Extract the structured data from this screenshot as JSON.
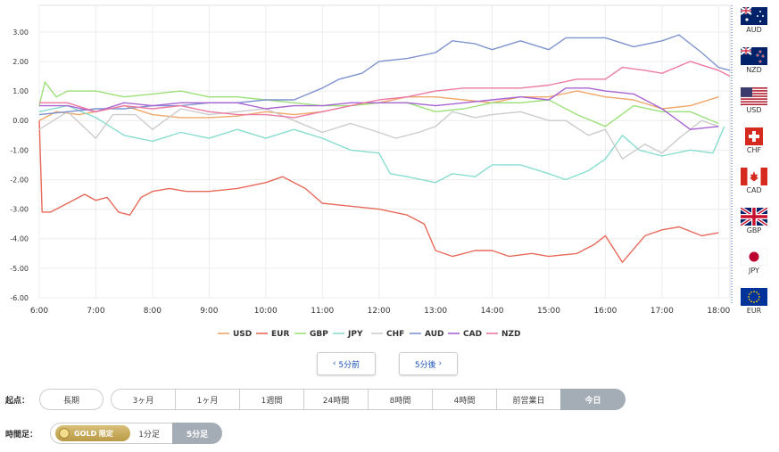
{
  "chart_data": {
    "type": "line",
    "title": "",
    "xlabel": "",
    "ylabel": "",
    "x_ticks": [
      "6:00",
      "7:00",
      "8:00",
      "9:00",
      "10:00",
      "11:00",
      "12:00",
      "13:00",
      "14:00",
      "15:00",
      "16:00",
      "17:00",
      "18:00"
    ],
    "x_range": [
      6.0,
      18.2
    ],
    "ylim": [
      -6.0,
      3.9
    ],
    "y_ticks": [
      "3.00",
      "2.00",
      "1.00",
      "0.00",
      "-1.00",
      "-2.00",
      "-3.00",
      "-4.00",
      "-5.00",
      "-6.00"
    ],
    "grid": true,
    "legend_position": "bottom",
    "series": [
      {
        "name": "USD",
        "color": "#f0a76a",
        "points": [
          [
            6,
            0
          ],
          [
            6.3,
            0.3
          ],
          [
            6.7,
            0.2
          ],
          [
            7,
            0.3
          ],
          [
            7.5,
            0.5
          ],
          [
            8,
            0.2
          ],
          [
            8.5,
            0.1
          ],
          [
            9,
            0.1
          ],
          [
            9.5,
            0.15
          ],
          [
            10,
            0.3
          ],
          [
            10.5,
            0.2
          ],
          [
            11,
            0.3
          ],
          [
            11.5,
            0.5
          ],
          [
            12,
            0.6
          ],
          [
            12.5,
            0.8
          ],
          [
            13,
            0.8
          ],
          [
            13.5,
            0.7
          ],
          [
            14,
            0.6
          ],
          [
            14.5,
            0.8
          ],
          [
            15,
            0.8
          ],
          [
            15.5,
            1.0
          ],
          [
            16,
            0.8
          ],
          [
            16.5,
            0.7
          ],
          [
            17,
            0.4
          ],
          [
            17.5,
            0.5
          ],
          [
            18,
            0.8
          ]
        ]
      },
      {
        "name": "EUR",
        "color": "#e8695a",
        "points": [
          [
            6,
            0
          ],
          [
            6.05,
            -3.1
          ],
          [
            6.2,
            -3.1
          ],
          [
            6.5,
            -2.8
          ],
          [
            6.8,
            -2.5
          ],
          [
            7,
            -2.7
          ],
          [
            7.2,
            -2.6
          ],
          [
            7.4,
            -3.1
          ],
          [
            7.6,
            -3.2
          ],
          [
            7.8,
            -2.6
          ],
          [
            8,
            -2.4
          ],
          [
            8.3,
            -2.3
          ],
          [
            8.6,
            -2.4
          ],
          [
            9,
            -2.4
          ],
          [
            9.5,
            -2.3
          ],
          [
            10,
            -2.1
          ],
          [
            10.3,
            -1.9
          ],
          [
            10.7,
            -2.3
          ],
          [
            11,
            -2.8
          ],
          [
            11.5,
            -2.9
          ],
          [
            12,
            -3.0
          ],
          [
            12.5,
            -3.2
          ],
          [
            12.8,
            -3.5
          ],
          [
            13,
            -4.4
          ],
          [
            13.3,
            -4.6
          ],
          [
            13.7,
            -4.4
          ],
          [
            14,
            -4.4
          ],
          [
            14.3,
            -4.6
          ],
          [
            14.7,
            -4.5
          ],
          [
            15,
            -4.6
          ],
          [
            15.5,
            -4.5
          ],
          [
            15.8,
            -4.2
          ],
          [
            16,
            -3.9
          ],
          [
            16.3,
            -4.8
          ],
          [
            16.7,
            -3.9
          ],
          [
            17,
            -3.7
          ],
          [
            17.3,
            -3.6
          ],
          [
            17.7,
            -3.9
          ],
          [
            18,
            -3.8
          ]
        ]
      },
      {
        "name": "GBP",
        "color": "#9de07a",
        "points": [
          [
            6,
            0.5
          ],
          [
            6.1,
            1.3
          ],
          [
            6.3,
            0.8
          ],
          [
            6.5,
            1.0
          ],
          [
            7,
            1.0
          ],
          [
            7.5,
            0.8
          ],
          [
            8,
            0.9
          ],
          [
            8.5,
            1.0
          ],
          [
            9,
            0.8
          ],
          [
            9.5,
            0.8
          ],
          [
            10,
            0.7
          ],
          [
            10.5,
            0.6
          ],
          [
            11,
            0.5
          ],
          [
            11.5,
            0.5
          ],
          [
            12,
            0.6
          ],
          [
            12.5,
            0.6
          ],
          [
            13,
            0.3
          ],
          [
            13.5,
            0.4
          ],
          [
            14,
            0.6
          ],
          [
            14.5,
            0.6
          ],
          [
            15,
            0.7
          ],
          [
            15.5,
            0.2
          ],
          [
            16,
            -0.2
          ],
          [
            16.5,
            0.5
          ],
          [
            17,
            0.3
          ],
          [
            17.5,
            0.3
          ],
          [
            18,
            -0.1
          ]
        ]
      },
      {
        "name": "JPY",
        "color": "#88ddd0",
        "points": [
          [
            6,
            0.3
          ],
          [
            6.5,
            0.5
          ],
          [
            7,
            0.1
          ],
          [
            7.5,
            -0.5
          ],
          [
            8,
            -0.7
          ],
          [
            8.5,
            -0.4
          ],
          [
            9,
            -0.6
          ],
          [
            9.5,
            -0.3
          ],
          [
            10,
            -0.6
          ],
          [
            10.5,
            -0.3
          ],
          [
            11,
            -0.6
          ],
          [
            11.5,
            -1.0
          ],
          [
            12,
            -1.1
          ],
          [
            12.2,
            -1.8
          ],
          [
            12.5,
            -1.9
          ],
          [
            13,
            -2.1
          ],
          [
            13.3,
            -1.8
          ],
          [
            13.7,
            -1.9
          ],
          [
            14,
            -1.5
          ],
          [
            14.5,
            -1.5
          ],
          [
            15,
            -1.8
          ],
          [
            15.3,
            -2.0
          ],
          [
            15.7,
            -1.7
          ],
          [
            16,
            -1.3
          ],
          [
            16.3,
            -0.5
          ],
          [
            16.6,
            -1.0
          ],
          [
            17,
            -1.2
          ],
          [
            17.5,
            -1.0
          ],
          [
            17.9,
            -1.1
          ],
          [
            18.1,
            -0.2
          ]
        ]
      },
      {
        "name": "CHF",
        "color": "#cccccc",
        "points": [
          [
            6,
            -0.3
          ],
          [
            6.5,
            0.3
          ],
          [
            7,
            -0.6
          ],
          [
            7.3,
            0.2
          ],
          [
            7.7,
            0.2
          ],
          [
            8,
            -0.3
          ],
          [
            8.5,
            0.4
          ],
          [
            9,
            0.2
          ],
          [
            9.5,
            0.3
          ],
          [
            10,
            0.4
          ],
          [
            10.5,
            0.0
          ],
          [
            11,
            -0.4
          ],
          [
            11.5,
            -0.1
          ],
          [
            12,
            -0.4
          ],
          [
            12.3,
            -0.6
          ],
          [
            12.7,
            -0.4
          ],
          [
            13,
            -0.2
          ],
          [
            13.3,
            0.3
          ],
          [
            13.7,
            0.1
          ],
          [
            14,
            0.2
          ],
          [
            14.5,
            0.3
          ],
          [
            15,
            0.0
          ],
          [
            15.3,
            0.0
          ],
          [
            15.7,
            -0.5
          ],
          [
            16,
            -0.3
          ],
          [
            16.3,
            -1.3
          ],
          [
            16.7,
            -0.8
          ],
          [
            17,
            -1.1
          ],
          [
            17.3,
            -0.6
          ],
          [
            17.7,
            0.0
          ],
          [
            18,
            -0.2
          ]
        ]
      },
      {
        "name": "AUD",
        "color": "#7e93cf",
        "points": [
          [
            6,
            0.2
          ],
          [
            6.5,
            0.3
          ],
          [
            7,
            0.4
          ],
          [
            7.5,
            0.4
          ],
          [
            8,
            0.5
          ],
          [
            8.5,
            0.5
          ],
          [
            9,
            0.6
          ],
          [
            9.5,
            0.6
          ],
          [
            10,
            0.7
          ],
          [
            10.5,
            0.7
          ],
          [
            11,
            1.1
          ],
          [
            11.3,
            1.4
          ],
          [
            11.7,
            1.6
          ],
          [
            12,
            2.0
          ],
          [
            12.5,
            2.1
          ],
          [
            13,
            2.3
          ],
          [
            13.3,
            2.7
          ],
          [
            13.7,
            2.6
          ],
          [
            14,
            2.4
          ],
          [
            14.5,
            2.7
          ],
          [
            15,
            2.4
          ],
          [
            15.3,
            2.8
          ],
          [
            15.7,
            2.8
          ],
          [
            16,
            2.8
          ],
          [
            16.5,
            2.5
          ],
          [
            17,
            2.7
          ],
          [
            17.3,
            2.9
          ],
          [
            17.7,
            2.3
          ],
          [
            18,
            1.8
          ],
          [
            18.2,
            1.7
          ]
        ]
      },
      {
        "name": "CAD",
        "color": "#a864d3",
        "points": [
          [
            6,
            0.5
          ],
          [
            6.5,
            0.5
          ],
          [
            7,
            0.3
          ],
          [
            7.5,
            0.6
          ],
          [
            8,
            0.5
          ],
          [
            8.5,
            0.6
          ],
          [
            9,
            0.6
          ],
          [
            9.5,
            0.6
          ],
          [
            10,
            0.4
          ],
          [
            10.5,
            0.5
          ],
          [
            11,
            0.5
          ],
          [
            11.5,
            0.6
          ],
          [
            12,
            0.6
          ],
          [
            12.5,
            0.6
          ],
          [
            13,
            0.5
          ],
          [
            13.5,
            0.6
          ],
          [
            14,
            0.7
          ],
          [
            14.5,
            0.8
          ],
          [
            15,
            0.7
          ],
          [
            15.3,
            1.1
          ],
          [
            15.7,
            1.1
          ],
          [
            16,
            1.0
          ],
          [
            16.5,
            0.9
          ],
          [
            17,
            0.4
          ],
          [
            17.5,
            -0.3
          ],
          [
            18,
            -0.2
          ]
        ]
      },
      {
        "name": "NZD",
        "color": "#ec7aa5",
        "points": [
          [
            6,
            0.6
          ],
          [
            6.5,
            0.6
          ],
          [
            7,
            0.3
          ],
          [
            7.5,
            0.5
          ],
          [
            8,
            0.4
          ],
          [
            8.5,
            0.5
          ],
          [
            9,
            0.3
          ],
          [
            9.5,
            0.2
          ],
          [
            10,
            0.2
          ],
          [
            10.5,
            0.1
          ],
          [
            11,
            0.3
          ],
          [
            11.5,
            0.5
          ],
          [
            12,
            0.7
          ],
          [
            12.5,
            0.8
          ],
          [
            13,
            1.0
          ],
          [
            13.5,
            1.1
          ],
          [
            14,
            1.1
          ],
          [
            14.5,
            1.1
          ],
          [
            15,
            1.2
          ],
          [
            15.5,
            1.4
          ],
          [
            16,
            1.4
          ],
          [
            16.3,
            1.8
          ],
          [
            16.7,
            1.7
          ],
          [
            17,
            1.6
          ],
          [
            17.5,
            2.0
          ],
          [
            18,
            1.7
          ],
          [
            18.2,
            1.5
          ]
        ]
      }
    ]
  },
  "legend": [
    "USD",
    "EUR",
    "GBP",
    "JPY",
    "CHF",
    "AUD",
    "CAD",
    "NZD"
  ],
  "flags": [
    {
      "code": "AUD",
      "icon": "australia-flag-icon"
    },
    {
      "code": "NZD",
      "icon": "new-zealand-flag-icon"
    },
    {
      "code": "USD",
      "icon": "usa-flag-icon"
    },
    {
      "code": "CHF",
      "icon": "swiss-flag-icon"
    },
    {
      "code": "CAD",
      "icon": "canada-flag-icon"
    },
    {
      "code": "GBP",
      "icon": "uk-flag-icon"
    },
    {
      "code": "JPY",
      "icon": "japan-flag-icon"
    },
    {
      "code": "EUR",
      "icon": "eu-flag-icon"
    }
  ],
  "nav": {
    "prev_label": "5分前",
    "next_label": "5分後"
  },
  "start": {
    "label": "起点：",
    "long_label": "長期",
    "options": [
      "3ヶ月",
      "1ヶ月",
      "1週間",
      "24時間",
      "8時間",
      "4時間",
      "前営業日",
      "今日"
    ],
    "active": "今日"
  },
  "interval": {
    "label": "時間足：",
    "gold_label": "GOLD 限定",
    "options": [
      "1分足",
      "5分足"
    ],
    "active": "5分足"
  }
}
